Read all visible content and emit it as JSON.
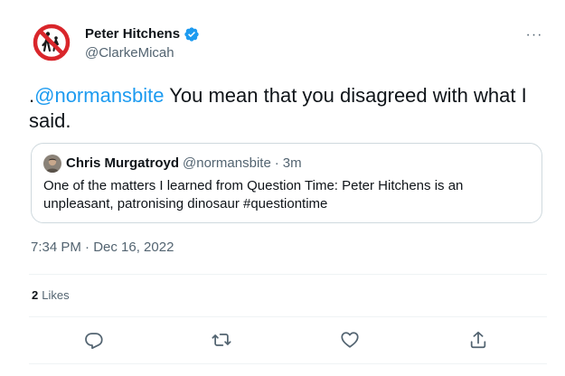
{
  "author": {
    "name": "Peter Hitchens",
    "handle": "@ClarkeMicah",
    "verified": true
  },
  "tweet": {
    "prefix": ".",
    "mention": "@normansbite",
    "text": " You mean that you disagreed with what I said."
  },
  "quoted_tweet": {
    "name": "Chris Murgatroyd",
    "handle": "@normansbite",
    "separator": "·",
    "time": "3m",
    "text": "One of the matters I learned from Question Time: Peter Hitchens is an unpleasant, patronising dinosaur #questiontime"
  },
  "timestamp": "7:34 PM · Dec 16, 2022",
  "stats": {
    "likes_count": "2",
    "likes_label": "Likes"
  },
  "more_label": "···",
  "colors": {
    "link": "#1d9bf0",
    "secondary_text": "#536471",
    "border": "#cfd9de",
    "avatar_sign_red": "#d9262b"
  },
  "icons": {
    "avatar": "no-pedestrians-sign-icon",
    "verified": "verified-badge-icon",
    "more": "more-horizontal-icon",
    "reply": "reply-icon",
    "retweet": "retweet-icon",
    "like": "heart-icon",
    "share": "share-icon"
  }
}
